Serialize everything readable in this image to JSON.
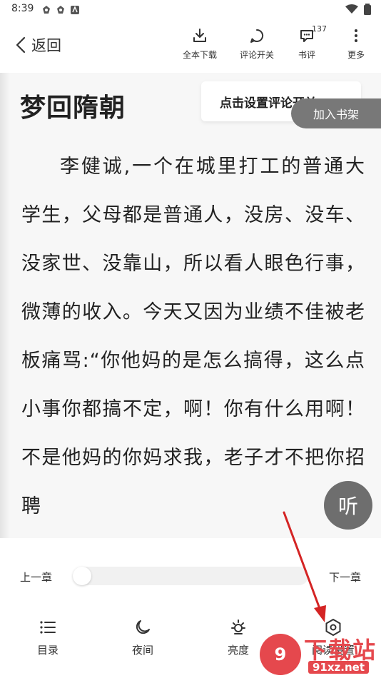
{
  "status_bar": {
    "time": "8:39"
  },
  "header": {
    "back_label": "返回",
    "actions": [
      {
        "label": "全本下载",
        "icon": "download-icon"
      },
      {
        "label": "评论开关",
        "icon": "comment-toggle-icon"
      },
      {
        "label": "书评",
        "icon": "review-icon",
        "badge": "137"
      },
      {
        "label": "更多",
        "icon": "more-icon"
      }
    ]
  },
  "reading": {
    "chapter_title": "梦回隋朝",
    "paragraph": "李健诚,一个在城里打工的普通大学生，父母都是普通人，没房、没车、没家世、没靠山，所以看人眼色行事，微薄的收入。今天又因为业绩不佳被老板痛骂:“你他妈的是怎么搞得，这么点小事你都搞不定，啊！你有什么用啊！不是他妈的你妈求我，老子才不把你招聘",
    "tooltip": "点击设置评论开关",
    "add_shelf": "加入书架",
    "listen": "听"
  },
  "bottom": {
    "prev_chapter": "上一章",
    "next_chapter": "下一章",
    "progress": 0,
    "tools": [
      {
        "label": "目录",
        "icon": "catalog-icon"
      },
      {
        "label": "夜间",
        "icon": "night-icon"
      },
      {
        "label": "亮度",
        "icon": "brightness-icon"
      },
      {
        "label": "阅读设置",
        "icon": "reading-settings-icon"
      }
    ]
  },
  "watermark": {
    "brand": "下载站",
    "url": "91xz.net",
    "logo": "9"
  },
  "colors": {
    "accent_arrow": "#d42424",
    "watermark_red": "#e5484d",
    "tag_gray": "#787878"
  }
}
